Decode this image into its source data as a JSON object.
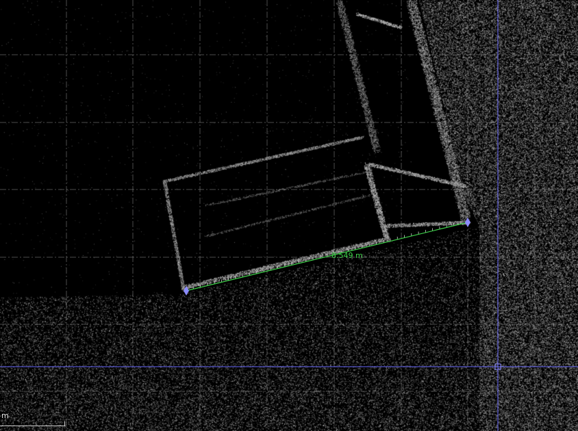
{
  "measurement": {
    "distance_label": "8.549 m",
    "line_color": "#3fd34a",
    "endpoint_color": "#8c8cff"
  },
  "crosshair": {
    "color": "#6a6aff"
  },
  "grid": {
    "color": "#8c8c8c"
  },
  "scale_bar": {
    "unit_label": "m"
  }
}
